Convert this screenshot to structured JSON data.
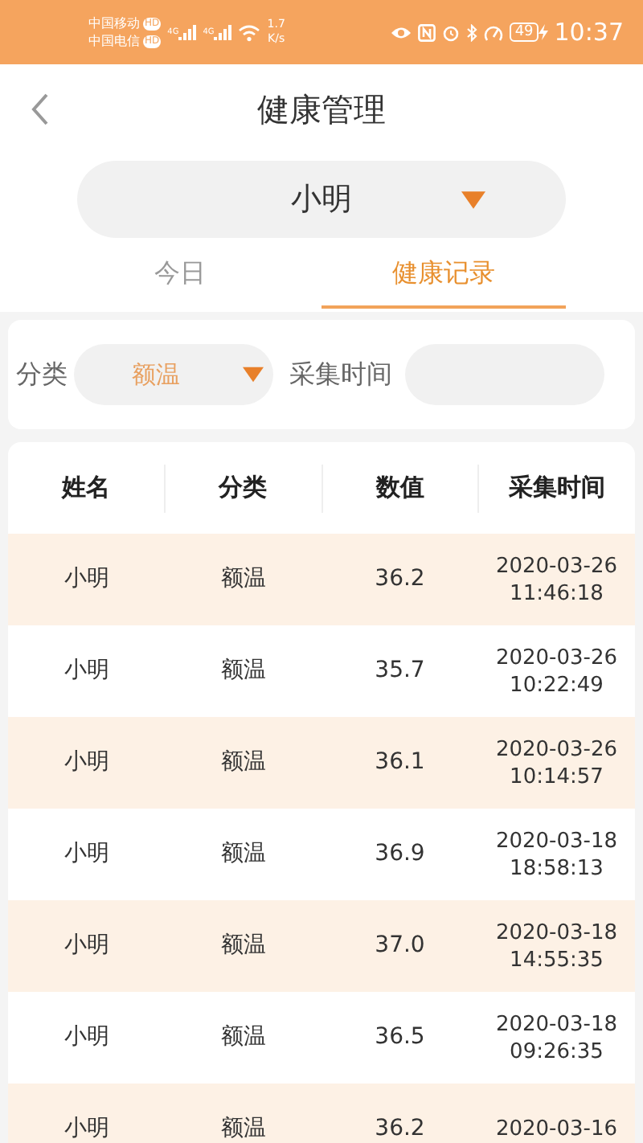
{
  "status_bar": {
    "carriers": [
      {
        "name": "中国移动",
        "badge": "HD",
        "network": "4G"
      },
      {
        "name": "中国电信",
        "badge": "HD",
        "network": "4G"
      }
    ],
    "speed": "1.7",
    "speed_unit": "K/s",
    "battery": "49",
    "time": "10:37"
  },
  "header": {
    "title": "健康管理"
  },
  "person_select": {
    "value": "小明"
  },
  "tabs": [
    {
      "label": "今日",
      "selected": false
    },
    {
      "label": "健康记录",
      "selected": true
    }
  ],
  "filters": {
    "category_label": "分类",
    "category_value": "额温",
    "time_label": "采集时间"
  },
  "table": {
    "columns": [
      "姓名",
      "分类",
      "数值",
      "采集时间"
    ],
    "rows": [
      {
        "name": "小明",
        "category": "额温",
        "value": "36.2",
        "date": "2020-03-26",
        "time": "11:46:18"
      },
      {
        "name": "小明",
        "category": "额温",
        "value": "35.7",
        "date": "2020-03-26",
        "time": "10:22:49"
      },
      {
        "name": "小明",
        "category": "额温",
        "value": "36.1",
        "date": "2020-03-26",
        "time": "10:14:57"
      },
      {
        "name": "小明",
        "category": "额温",
        "value": "36.9",
        "date": "2020-03-18",
        "time": "18:58:13"
      },
      {
        "name": "小明",
        "category": "额温",
        "value": "37.0",
        "date": "2020-03-18",
        "time": "14:55:35"
      },
      {
        "name": "小明",
        "category": "额温",
        "value": "36.5",
        "date": "2020-03-18",
        "time": "09:26:35"
      },
      {
        "name": "小明",
        "category": "额温",
        "value": "36.2",
        "date": "2020-03-16"
      }
    ]
  }
}
